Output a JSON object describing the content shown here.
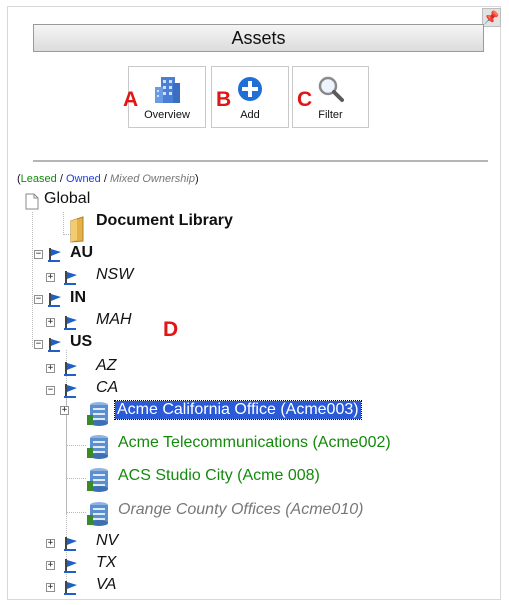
{
  "panel": {
    "title": "Assets",
    "pin_icon": "pin-icon"
  },
  "toolbar": {
    "overview_label": "Overview",
    "add_label": "Add",
    "filter_label": "Filter"
  },
  "markers": {
    "a": "A",
    "b": "B",
    "c": "C",
    "d": "D"
  },
  "legend": {
    "open": "(",
    "leased": "Leased",
    "sep1": " / ",
    "owned": "Owned",
    "sep2": " / ",
    "mixed": "Mixed Ownership",
    "close": ")"
  },
  "colors": {
    "leased": "#138a0b",
    "owned": "#1f3fe0",
    "mixed": "#777777",
    "selected": "#2a5ad6",
    "marker": "#e01515"
  },
  "tree": {
    "global": "Global",
    "document_library": "Document Library",
    "au": "AU",
    "nsw": "NSW",
    "in": "IN",
    "mah": "MAH",
    "us": "US",
    "az": "AZ",
    "ca": "CA",
    "acme_california": "Acme California Office (Acme003)",
    "acme_telecom": "Acme Telecommunications (Acme002)",
    "acs_studio": "ACS Studio City (Acme 008)",
    "orange_county": "Orange County Offices (Acme010)",
    "nv": "NV",
    "tx": "TX",
    "va": "VA"
  }
}
